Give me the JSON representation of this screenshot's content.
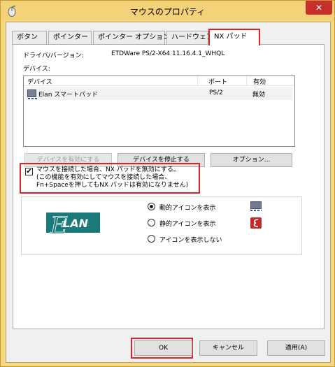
{
  "window": {
    "title": "マウスのプロパティ",
    "close_label": "✕"
  },
  "tabs": [
    {
      "label": "ボタン"
    },
    {
      "label": "ポインター"
    },
    {
      "label": "ポインター オプション"
    },
    {
      "label": "ハードウェア"
    },
    {
      "label": "NX パッド"
    }
  ],
  "driver": {
    "label": "ドライバ/バージョン:",
    "value": "ETDWare PS/2-X64 11.16.4.1_WHQL"
  },
  "devices_label": "デバイス:",
  "device_list": {
    "columns": [
      "デバイス",
      "ポート",
      "有効"
    ],
    "rows": [
      {
        "device": "Elan スマートパッド",
        "port": "PS/2",
        "enabled": "無効"
      }
    ]
  },
  "buttons": {
    "enable": "デバイスを有効にする",
    "stop": "デバイスを停止する",
    "options": "オプション..."
  },
  "checkbox": {
    "checked": "✔",
    "line1": "マウスを接続した場合、NX パッドを無効にする。",
    "line2": "(この機能を有効にしてマウスを接続した場合、",
    "line3": "Fn+Spaceを押してもNX パッドは有効になりません)"
  },
  "logo": {
    "text": "LAN",
    "letter": "E"
  },
  "tray_options": [
    {
      "label": "動的アイコンを表示",
      "selected": true
    },
    {
      "label": "静的アイコンを表示",
      "selected": false
    },
    {
      "label": "アイコンを表示しない",
      "selected": false
    }
  ],
  "dialog_buttons": {
    "ok": "OK",
    "cancel": "キャンセル",
    "apply": "適用(A)"
  },
  "colors": {
    "highlight": "#e0202a",
    "elan_teal": "#1a7a7a",
    "title_bar": "#f3d27a"
  }
}
